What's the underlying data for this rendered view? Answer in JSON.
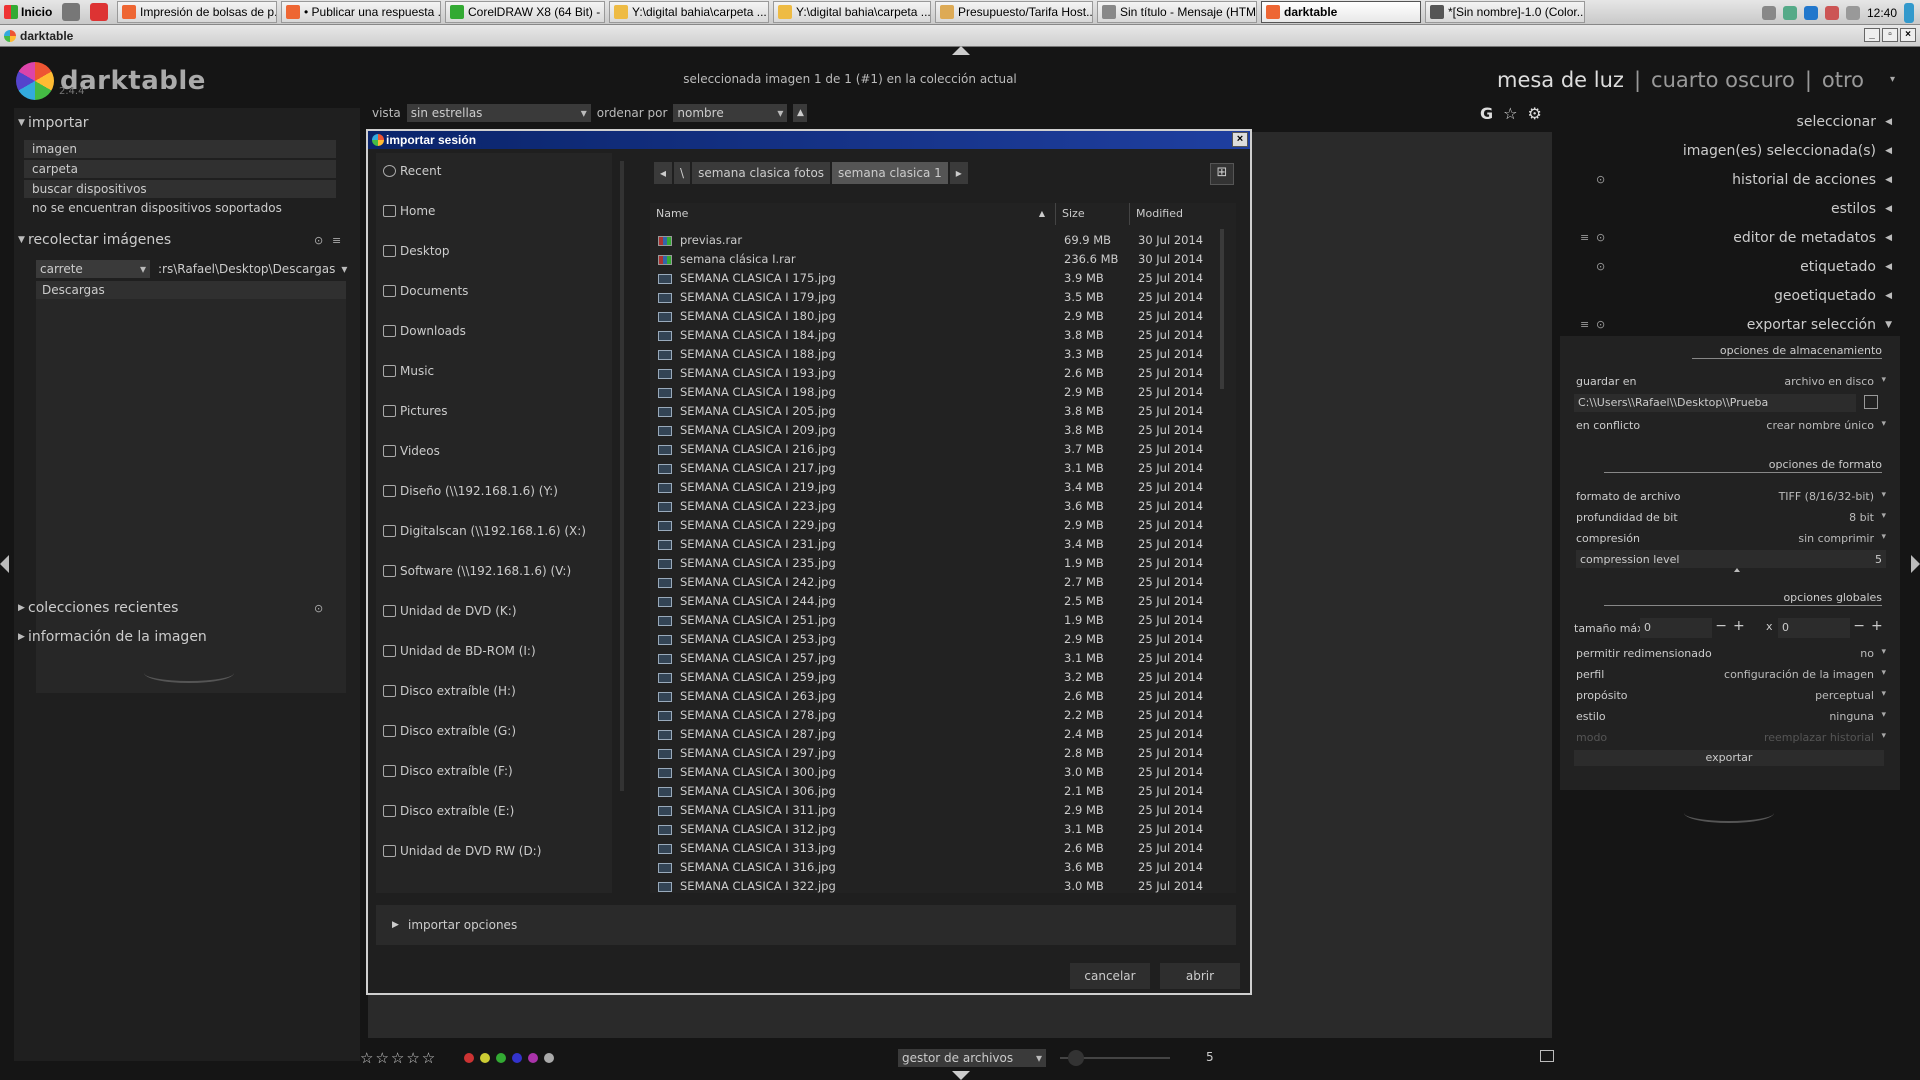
{
  "taskbar": {
    "start_label": "Inicio",
    "buttons": [
      "Impresión de bolsas de p...",
      "• Publicar una respuesta ...",
      "CorelDRAW X8 (64 Bit) - ...",
      "Y:\\digital bahia\\carpeta ...",
      "Y:\\digital bahia\\carpeta ...",
      "Presupuesto/Tarifa Host...",
      "Sin título - Mensaje (HTML)",
      "darktable",
      "*[Sin nombre]-1.0 (Color..."
    ],
    "clock": "12:40"
  },
  "window": {
    "title": "darktable"
  },
  "app": {
    "logo": "darktable",
    "version": "2.4.4",
    "status": "seleccionada imagen 1 de 1 (#1) en la colección actual",
    "views": {
      "lighttable": "mesa de luz",
      "sep": "|",
      "darkroom": "cuarto oscuro",
      "other": "otro"
    }
  },
  "filter": {
    "view_label": "vista",
    "view_value": "sin estrellas",
    "sort_label": "ordenar por",
    "sort_value": "nombre",
    "sort_dir": "▲"
  },
  "left": {
    "import_title": "importar",
    "import_items": [
      "imagen",
      "carpeta",
      "buscar dispositivos",
      "no se encuentran dispositivos soportados"
    ],
    "collect_title": "recolectar imágenes",
    "collect_mode": "carrete",
    "collect_path": ":rs\\Rafael\\Desktop\\Descargas",
    "collect_item": "Descargas",
    "recent_title": "colecciones recientes",
    "info_title": "información de la imagen"
  },
  "right": {
    "headers": [
      "seleccionar",
      "imagen(es) seleccionada(s)",
      "historial de acciones",
      "estilos",
      "editor de metadatos",
      "etiquetado",
      "geoetiquetado",
      "exportar selección"
    ],
    "storage_title": "opciones de almacenamiento",
    "save_in_label": "guardar en",
    "save_in_value": "archivo en disco",
    "path": "C:\\\\Users\\\\Rafael\\\\Desktop\\\\Prueba",
    "conflict_label": "en conflicto",
    "conflict_value": "crear nombre único",
    "format_title": "opciones de formato",
    "file_format_label": "formato de archivo",
    "file_format_value": "TIFF (8/16/32-bit)",
    "bitdepth_label": "profundidad de bit",
    "bitdepth_value": "8 bit",
    "compression_label": "compresión",
    "compression_value": "sin comprimir",
    "complevel_label": "compression level",
    "complevel_value": "5",
    "global_title": "opciones globales",
    "maxsize_label": "tamaño máx",
    "maxsize_w": "0",
    "maxsize_x": "x",
    "maxsize_h": "0",
    "upscale_label": "permitir redimensionado",
    "upscale_value": "no",
    "profile_label": "perfil",
    "profile_value": "configuración de la imagen",
    "intent_label": "propósito",
    "intent_value": "perceptual",
    "style_label": "estilo",
    "style_value": "ninguna",
    "mode_label": "modo",
    "mode_value": "reemplazar historial",
    "export_btn": "exportar"
  },
  "bottom": {
    "stars": "☆☆☆☆☆",
    "color_labels": [
      "#c33",
      "#cc3",
      "#3a3",
      "#33c",
      "#a3a",
      "#aaa"
    ],
    "layout_value": "gestor de archivos",
    "zoom_value": "5"
  },
  "dialog": {
    "title": "importar sesión",
    "places": [
      "Recent",
      "Home",
      "Desktop",
      "Documents",
      "Downloads",
      "Music",
      "Pictures",
      "Videos",
      "Diseño (\\\\192.168.1.6) (Y:)",
      "Digitalscan (\\\\192.168.1.6) (X:)",
      "Software (\\\\192.168.1.6) (V:)",
      "Unidad de DVD (K:)",
      "Unidad de BD-ROM (I:)",
      "Disco extraíble (H:)",
      "Disco extraíble (G:)",
      "Disco extraíble (F:)",
      "Disco extraíble (E:)",
      "Unidad de DVD RW (D:)"
    ],
    "crumbs": [
      "\\",
      "semana clasica fotos",
      "semana clasica 1"
    ],
    "col_name": "Name",
    "col_size": "Size",
    "col_modified": "Modified",
    "files": [
      {
        "name": "previas.rar",
        "size": "69.9 MB",
        "date": "30 Jul 2014",
        "type": "rar"
      },
      {
        "name": "semana clásica I.rar",
        "size": "236.6 MB",
        "date": "30 Jul 2014",
        "type": "rar"
      },
      {
        "name": "SEMANA CLASICA I 175.jpg",
        "size": "3.9 MB",
        "date": "25 Jul 2014",
        "type": "img"
      },
      {
        "name": "SEMANA CLASICA I 179.jpg",
        "size": "3.5 MB",
        "date": "25 Jul 2014",
        "type": "img"
      },
      {
        "name": "SEMANA CLASICA I 180.jpg",
        "size": "2.9 MB",
        "date": "25 Jul 2014",
        "type": "img"
      },
      {
        "name": "SEMANA CLASICA I 184.jpg",
        "size": "3.8 MB",
        "date": "25 Jul 2014",
        "type": "img"
      },
      {
        "name": "SEMANA CLASICA I 188.jpg",
        "size": "3.3 MB",
        "date": "25 Jul 2014",
        "type": "img"
      },
      {
        "name": "SEMANA CLASICA I 193.jpg",
        "size": "2.6 MB",
        "date": "25 Jul 2014",
        "type": "img"
      },
      {
        "name": "SEMANA CLASICA I 198.jpg",
        "size": "2.9 MB",
        "date": "25 Jul 2014",
        "type": "img"
      },
      {
        "name": "SEMANA CLASICA I 205.jpg",
        "size": "3.8 MB",
        "date": "25 Jul 2014",
        "type": "img"
      },
      {
        "name": "SEMANA CLASICA I 209.jpg",
        "size": "3.8 MB",
        "date": "25 Jul 2014",
        "type": "img"
      },
      {
        "name": "SEMANA CLASICA I 216.jpg",
        "size": "3.7 MB",
        "date": "25 Jul 2014",
        "type": "img"
      },
      {
        "name": "SEMANA CLASICA I 217.jpg",
        "size": "3.1 MB",
        "date": "25 Jul 2014",
        "type": "img"
      },
      {
        "name": "SEMANA CLASICA I 219.jpg",
        "size": "3.4 MB",
        "date": "25 Jul 2014",
        "type": "img"
      },
      {
        "name": "SEMANA CLASICA I 223.jpg",
        "size": "3.6 MB",
        "date": "25 Jul 2014",
        "type": "img"
      },
      {
        "name": "SEMANA CLASICA I 229.jpg",
        "size": "2.9 MB",
        "date": "25 Jul 2014",
        "type": "img"
      },
      {
        "name": "SEMANA CLASICA I 231.jpg",
        "size": "3.4 MB",
        "date": "25 Jul 2014",
        "type": "img"
      },
      {
        "name": "SEMANA CLASICA I 235.jpg",
        "size": "1.9 MB",
        "date": "25 Jul 2014",
        "type": "img"
      },
      {
        "name": "SEMANA CLASICA I 242.jpg",
        "size": "2.7 MB",
        "date": "25 Jul 2014",
        "type": "img"
      },
      {
        "name": "SEMANA CLASICA I 244.jpg",
        "size": "2.5 MB",
        "date": "25 Jul 2014",
        "type": "img"
      },
      {
        "name": "SEMANA CLASICA I 251.jpg",
        "size": "1.9 MB",
        "date": "25 Jul 2014",
        "type": "img"
      },
      {
        "name": "SEMANA CLASICA I 253.jpg",
        "size": "2.9 MB",
        "date": "25 Jul 2014",
        "type": "img"
      },
      {
        "name": "SEMANA CLASICA I 257.jpg",
        "size": "3.1 MB",
        "date": "25 Jul 2014",
        "type": "img"
      },
      {
        "name": "SEMANA CLASICA I 259.jpg",
        "size": "3.2 MB",
        "date": "25 Jul 2014",
        "type": "img"
      },
      {
        "name": "SEMANA CLASICA I 263.jpg",
        "size": "2.6 MB",
        "date": "25 Jul 2014",
        "type": "img"
      },
      {
        "name": "SEMANA CLASICA I 278.jpg",
        "size": "2.2 MB",
        "date": "25 Jul 2014",
        "type": "img"
      },
      {
        "name": "SEMANA CLASICA I 287.jpg",
        "size": "2.4 MB",
        "date": "25 Jul 2014",
        "type": "img"
      },
      {
        "name": "SEMANA CLASICA I 297.jpg",
        "size": "2.8 MB",
        "date": "25 Jul 2014",
        "type": "img"
      },
      {
        "name": "SEMANA CLASICA I 300.jpg",
        "size": "3.0 MB",
        "date": "25 Jul 2014",
        "type": "img"
      },
      {
        "name": "SEMANA CLASICA I 306.jpg",
        "size": "2.1 MB",
        "date": "25 Jul 2014",
        "type": "img"
      },
      {
        "name": "SEMANA CLASICA I 311.jpg",
        "size": "2.9 MB",
        "date": "25 Jul 2014",
        "type": "img"
      },
      {
        "name": "SEMANA CLASICA I 312.jpg",
        "size": "3.1 MB",
        "date": "25 Jul 2014",
        "type": "img"
      },
      {
        "name": "SEMANA CLASICA I 313.jpg",
        "size": "2.6 MB",
        "date": "25 Jul 2014",
        "type": "img"
      },
      {
        "name": "SEMANA CLASICA I 316.jpg",
        "size": "3.6 MB",
        "date": "25 Jul 2014",
        "type": "img"
      },
      {
        "name": "SEMANA CLASICA I 322.jpg",
        "size": "3.0 MB",
        "date": "25 Jul 2014",
        "type": "img"
      }
    ],
    "import_options": "importar opciones",
    "cancel": "cancelar",
    "open": "abrir"
  }
}
